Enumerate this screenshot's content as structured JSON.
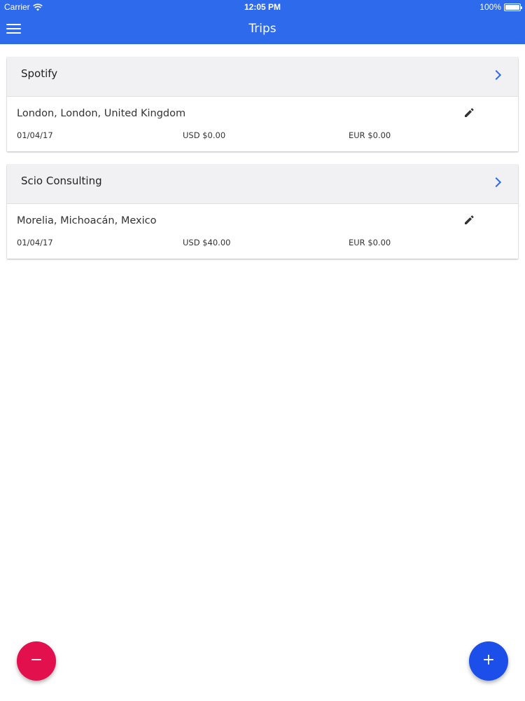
{
  "status_bar": {
    "carrier": "Carrier",
    "time": "12:05 PM",
    "battery": "100%"
  },
  "nav": {
    "title": "Trips",
    "menu_icon": "hamburger-menu-icon"
  },
  "trips": [
    {
      "company": "Spotify",
      "location": "London, London, United Kingdom",
      "date": "01/04/17",
      "usd": "USD $0.00",
      "eur": "EUR $0.00"
    },
    {
      "company": "Scio Consulting",
      "location": "Morelia, Michoacán, Mexico",
      "date": "01/04/17",
      "usd": "USD $40.00",
      "eur": "EUR $0.00"
    }
  ],
  "fab": {
    "remove_label": "−",
    "add_label": "+"
  },
  "colors": {
    "primary": "#2e6bec",
    "fab_add": "#1c4fea",
    "fab_remove": "#e2104d",
    "card_header_bg": "#f1f1f3"
  }
}
